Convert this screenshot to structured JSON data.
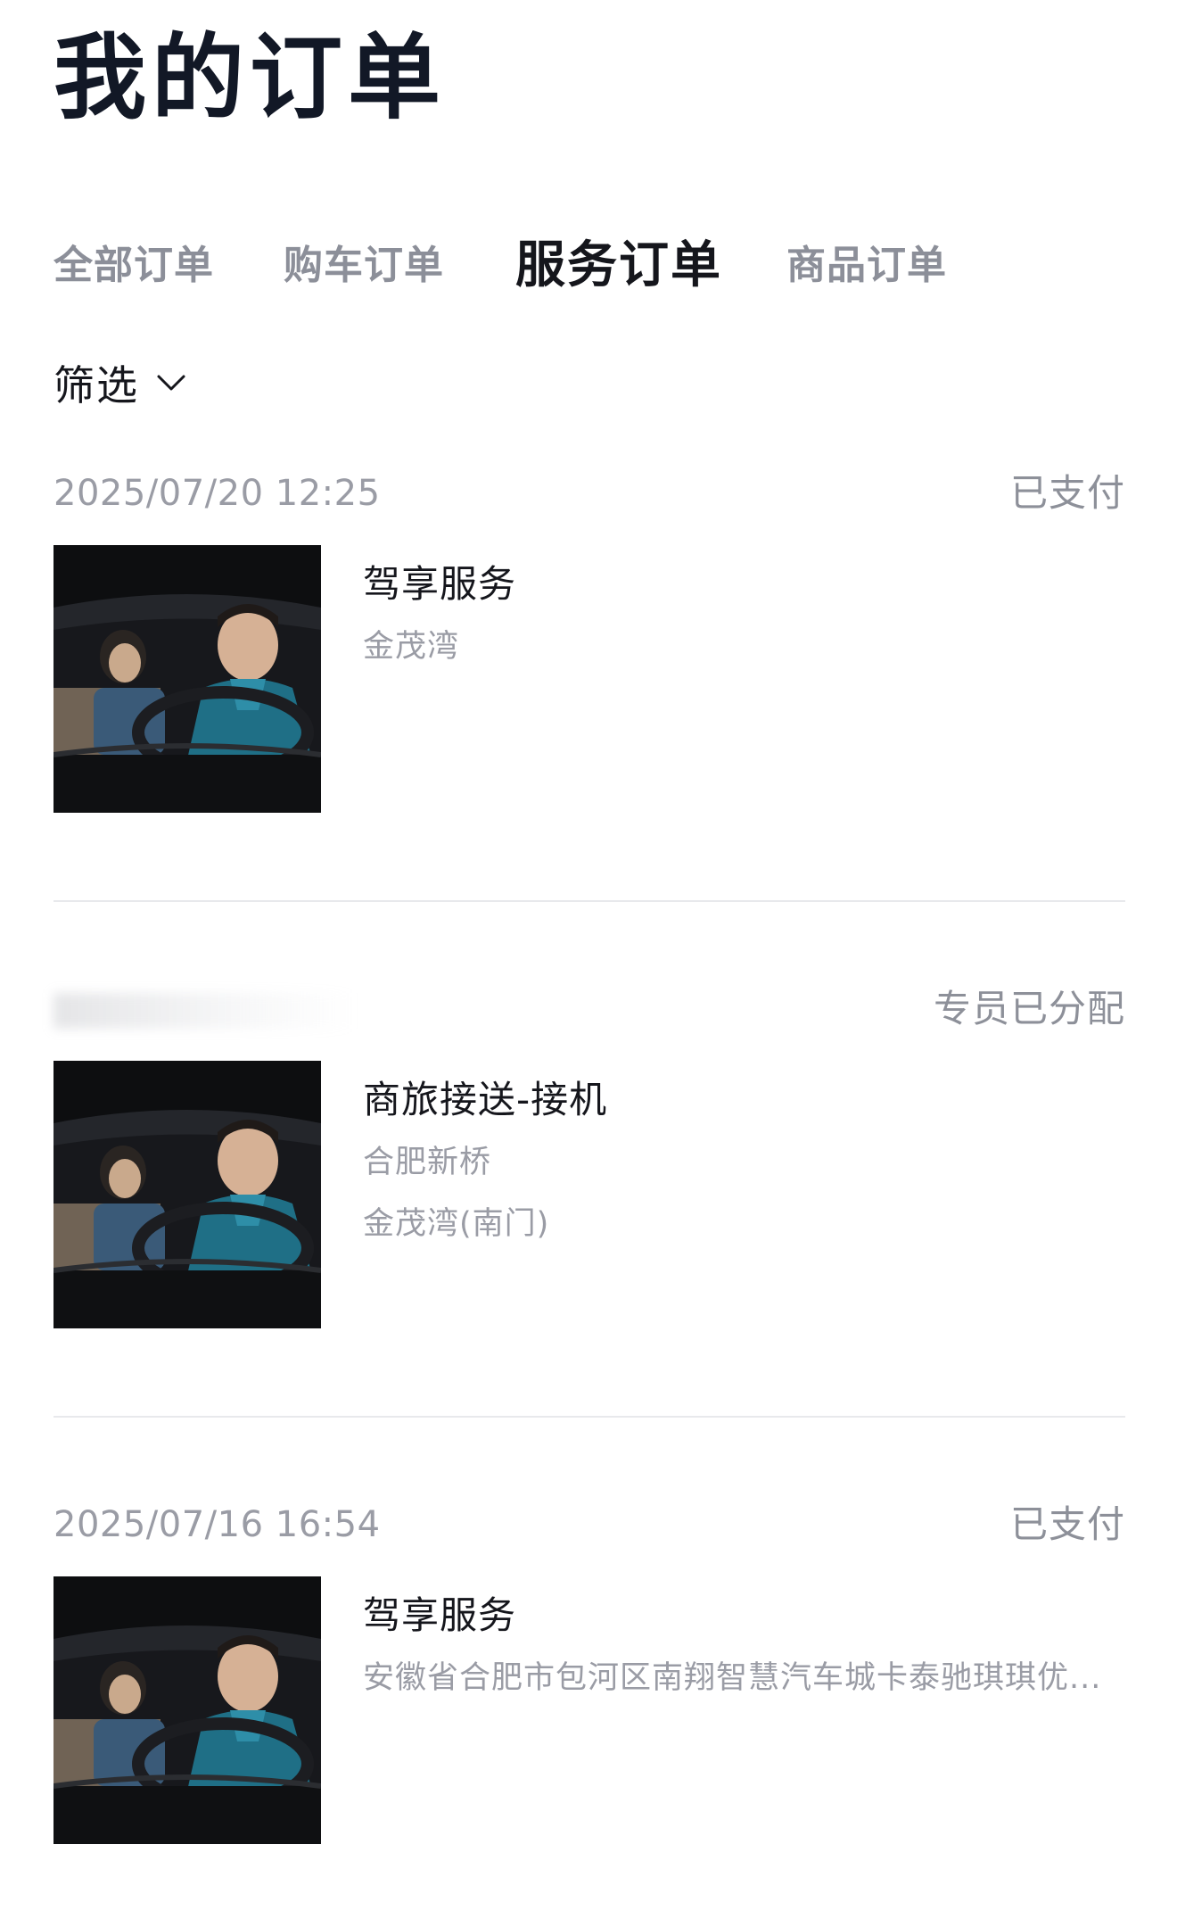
{
  "page": {
    "title": "我的订单"
  },
  "tabs": [
    {
      "label": "全部订单",
      "active": false
    },
    {
      "label": "购车订单",
      "active": false
    },
    {
      "label": "服务订单",
      "active": true
    },
    {
      "label": "商品订单",
      "active": false
    }
  ],
  "filter": {
    "label": "筛选",
    "icon": "chevron-down-icon"
  },
  "orders": [
    {
      "time": "2025/07/20 12:25",
      "status": "已支付",
      "title": "驾享服务",
      "lines": [
        "金茂湾"
      ],
      "image": "driver-photo"
    },
    {
      "time": "",
      "time_redacted": true,
      "status": "专员已分配",
      "title": "商旅接送-接机",
      "lines": [
        "合肥新桥",
        "金茂湾(南门)"
      ],
      "image": "driver-photo"
    },
    {
      "time": "2025/07/16 16:54",
      "status": "已支付",
      "title": "驾享服务",
      "lines": [
        "安徽省合肥市包河区南翔智慧汽车城卡泰驰琪琪优..."
      ],
      "image": "driver-photo"
    }
  ],
  "colors": {
    "text_primary": "#15161c",
    "text_secondary": "#9a9ca5",
    "divider": "#e8e9ec",
    "background": "#ffffff"
  }
}
